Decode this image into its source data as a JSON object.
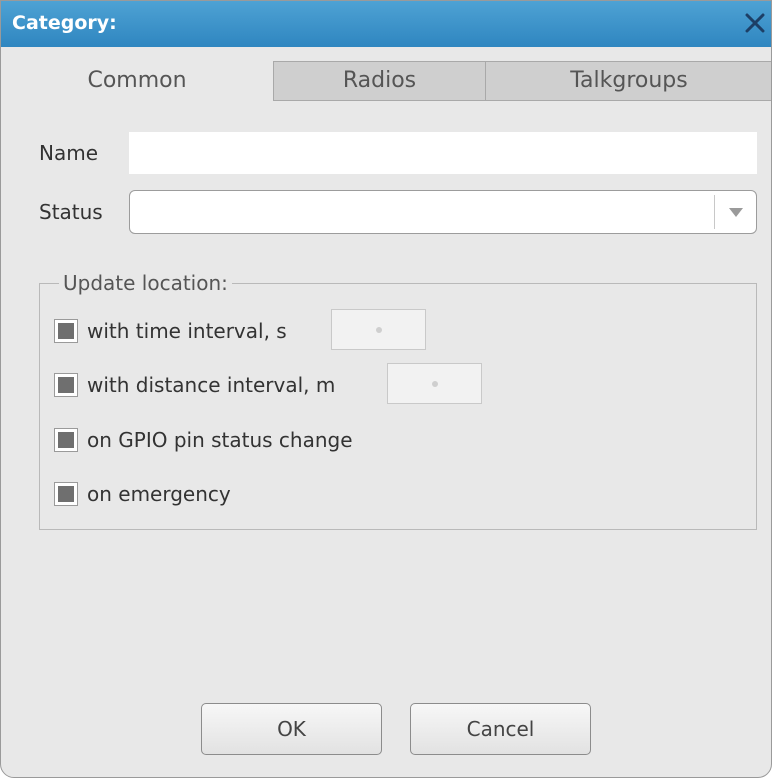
{
  "window": {
    "title": "Category:",
    "title_bar_color": "#3a92c9"
  },
  "icons": {
    "close": "close-icon",
    "dropdown": "chevron-down-icon"
  },
  "tabs": [
    {
      "label": "Common",
      "active": true
    },
    {
      "label": "Radios",
      "active": false
    },
    {
      "label": "Talkgroups",
      "active": false
    }
  ],
  "form": {
    "name_label": "Name",
    "name_value": "",
    "status_label": "Status",
    "status_value": ""
  },
  "update_location": {
    "legend": "Update location:",
    "options": [
      {
        "label": "with time interval, s",
        "state": "indeterminate",
        "value": ""
      },
      {
        "label": "with distance interval, m",
        "state": "indeterminate",
        "value": ""
      },
      {
        "label": "on GPIO pin status change",
        "state": "indeterminate"
      },
      {
        "label": "on emergency",
        "state": "indeterminate"
      }
    ]
  },
  "buttons": {
    "ok": "OK",
    "cancel": "Cancel"
  }
}
